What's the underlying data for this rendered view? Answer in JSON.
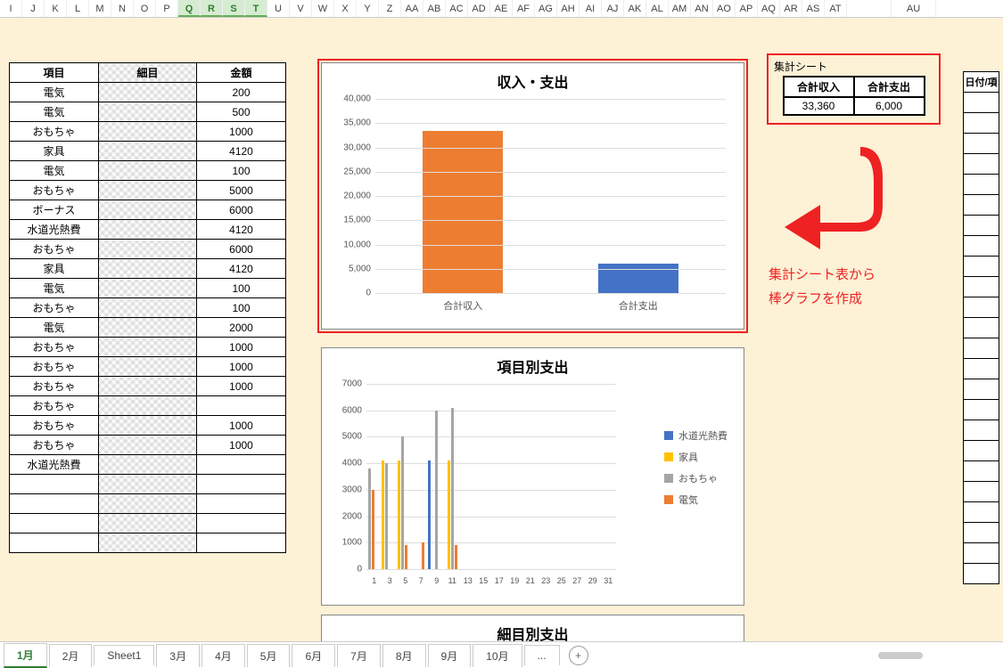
{
  "columns": [
    "I",
    "J",
    "K",
    "L",
    "M",
    "N",
    "O",
    "P",
    "Q",
    "R",
    "S",
    "T",
    "U",
    "V",
    "W",
    "X",
    "Y",
    "Z",
    "AA",
    "AB",
    "AC",
    "AD",
    "AE",
    "AF",
    "AG",
    "AH",
    "AI",
    "AJ",
    "AK",
    "AL",
    "AM",
    "AN",
    "AO",
    "AP",
    "AQ",
    "AR",
    "AS",
    "AT",
    "",
    "AU"
  ],
  "selected_cols": [
    "Q",
    "R",
    "S",
    "T"
  ],
  "data_table": {
    "headers": [
      "項目",
      "細目",
      "金額"
    ],
    "rows": [
      {
        "item": "電気",
        "amount": "200"
      },
      {
        "item": "電気",
        "amount": "500"
      },
      {
        "item": "おもちゃ",
        "amount": "1000"
      },
      {
        "item": "家具",
        "amount": "4120"
      },
      {
        "item": "電気",
        "amount": "100"
      },
      {
        "item": "おもちゃ",
        "amount": "5000"
      },
      {
        "item": "ボーナス",
        "amount": "6000"
      },
      {
        "item": "水道光熱費",
        "amount": "4120"
      },
      {
        "item": "おもちゃ",
        "amount": "6000"
      },
      {
        "item": "家具",
        "amount": "4120"
      },
      {
        "item": "電気",
        "amount": "100"
      },
      {
        "item": "おもちゃ",
        "amount": "100"
      },
      {
        "item": "電気",
        "amount": "2000"
      },
      {
        "item": "おもちゃ",
        "amount": "1000"
      },
      {
        "item": "おもちゃ",
        "amount": "1000"
      },
      {
        "item": "おもちゃ",
        "amount": "1000"
      },
      {
        "item": "おもちゃ",
        "amount": ""
      },
      {
        "item": "おもちゃ",
        "amount": "1000"
      },
      {
        "item": "おもちゃ",
        "amount": "1000"
      },
      {
        "item": "水道光熱費",
        "amount": ""
      },
      {
        "item": "",
        "amount": ""
      },
      {
        "item": "",
        "amount": ""
      },
      {
        "item": "",
        "amount": ""
      },
      {
        "item": "",
        "amount": ""
      }
    ]
  },
  "summary": {
    "label": "集計シート",
    "headers": [
      "合計収入",
      "合計支出"
    ],
    "values": [
      "33,360",
      "6,000"
    ]
  },
  "annotation": {
    "line1": "集計シート表から",
    "line2": "棒グラフを作成"
  },
  "right_table_header": "日付/項",
  "chart1_title": "収入・支出",
  "chart2_title": "項目別支出",
  "chart3_title": "細目別支出",
  "chart_data": [
    {
      "type": "bar",
      "title": "収入・支出",
      "categories": [
        "合計収入",
        "合計支出"
      ],
      "values": [
        33360,
        6000
      ],
      "ylim": [
        0,
        40000
      ],
      "ystep": 5000,
      "colors": [
        "#ed7d31",
        "#4472c4"
      ]
    },
    {
      "type": "bar",
      "title": "項目別支出",
      "x": [
        1,
        3,
        5,
        7,
        9,
        11,
        13,
        15,
        17,
        19,
        21,
        23,
        25,
        27,
        29,
        31
      ],
      "ylim": [
        0,
        7000
      ],
      "ystep": 1000,
      "series": [
        {
          "name": "水道光熱費",
          "color": "#4472c4",
          "points": {
            "1": 0,
            "9": 4100
          }
        },
        {
          "name": "家具",
          "color": "#ffc000",
          "points": {
            "3": 4100,
            "5": 4100,
            "11": 4100
          }
        },
        {
          "name": "おもちゃ",
          "color": "#a5a5a5",
          "points": {
            "1": 3800,
            "3": 4000,
            "5": 5000,
            "9": 6000,
            "11": 6100
          }
        },
        {
          "name": "電気",
          "color": "#ed7d31",
          "points": {
            "1": 3000,
            "5": 900,
            "7": 1000,
            "11": 900
          }
        }
      ]
    }
  ],
  "tabs": [
    "1月",
    "2月",
    "Sheet1",
    "3月",
    "4月",
    "5月",
    "6月",
    "7月",
    "8月",
    "9月",
    "10月",
    "..."
  ],
  "active_tab": "1月"
}
